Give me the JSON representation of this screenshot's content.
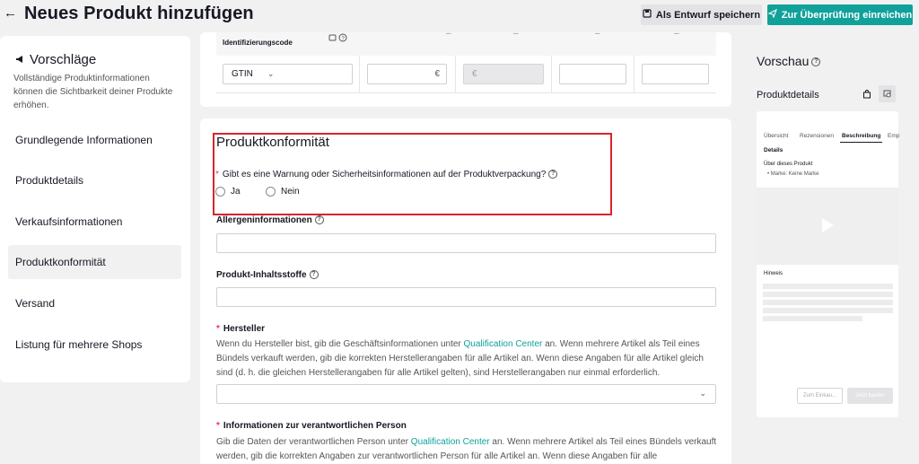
{
  "header": {
    "title": "Neues Produkt hinzufügen",
    "save_draft_label": "Als Entwurf speichern",
    "submit_label": "Zur Überprüfung einreichen"
  },
  "sidebar": {
    "suggestions_title": "Vorschläge",
    "suggestions_desc": "Vollständige Produktinformationen können die Sichtbarkeit deiner Produkte erhöhen.",
    "items": [
      {
        "label": "Grundlegende Informationen"
      },
      {
        "label": "Produktdetails"
      },
      {
        "label": "Verkaufsinformationen"
      },
      {
        "label": "Produktkonformität",
        "active": true
      },
      {
        "label": "Versand"
      },
      {
        "label": "Listung für mehrere Shops"
      }
    ]
  },
  "variant_table": {
    "id_code_header": "Identifizierungscode",
    "gtin_select": "GTIN",
    "price_suffix": "€",
    "disabled_price_placeholder": "€"
  },
  "conformity": {
    "section_title": "Produktkonformität",
    "warning_question": "Gibt es eine Warnung oder Sicherheitsinformationen auf der Produktverpackung?",
    "option_yes": "Ja",
    "option_no": "Nein",
    "allergen_label": "Allergeninformationen",
    "ingredients_label": "Produkt-Inhaltsstoffe",
    "manufacturer_label": "Hersteller",
    "manufacturer_desc_1": "Wenn du Hersteller bist, gib die Geschäftsinformationen unter",
    "manufacturer_link": "Qualification Center",
    "manufacturer_desc_2": "an. Wenn mehrere Artikel als Teil eines Bündels verkauft werden, gib die korrekten Herstellerangaben für alle Artikel an. Wenn diese Angaben für alle Artikel gleich sind (d. h. die gleichen Herstellerangaben für alle Artikel gelten), sind Herstellerangaben nur einmal erforderlich.",
    "responsible_label": "Informationen zur verantwortlichen Person",
    "responsible_desc_1": "Gib die Daten der verantwortlichen Person unter",
    "responsible_link": "Qualification Center",
    "responsible_desc_2": "an. Wenn mehrere Artikel als Teil eines Bündels verkauft werden, gib die korrekten Angaben zur verantwortlichen Person für alle Artikel an. Wenn diese Angaben für alle"
  },
  "preview": {
    "title": "Vorschau",
    "details_label": "Produktdetails",
    "tabs": [
      "Übersicht",
      "Rezensionen",
      "Beschreibung",
      "Emp"
    ],
    "details_heading": "Details",
    "about_product": "Über dieses Produkt",
    "brand_line": "Marke: Keine Marke",
    "notice": "Hinweis",
    "cart_button": "Zum Einkau...",
    "buy_button": "Jetzt kaufen"
  },
  "colors": {
    "accent": "#10a19a",
    "highlight_box": "#d8262b",
    "required": "#fe2c55"
  }
}
